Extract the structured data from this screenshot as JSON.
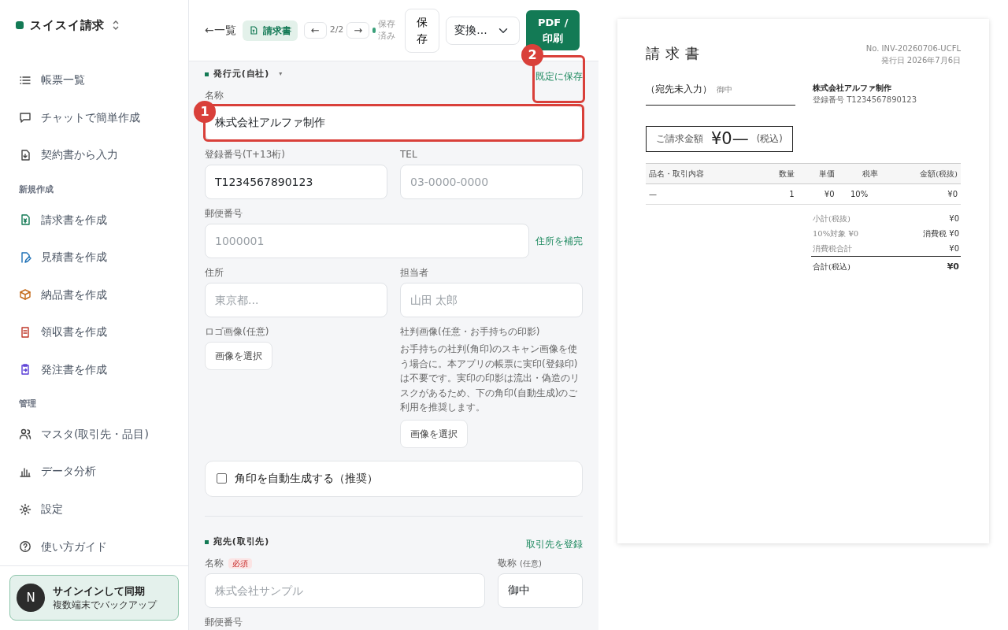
{
  "sidebar": {
    "brand": "スイスイ請求",
    "groups": [
      {
        "items": [
          {
            "label": "帳票一覧"
          },
          {
            "label": "チャットで簡単作成"
          },
          {
            "label": "契約書から入力"
          }
        ]
      },
      {
        "heading": "新規作成",
        "items": [
          {
            "label": "請求書を作成"
          },
          {
            "label": "見積書を作成"
          },
          {
            "label": "納品書を作成"
          },
          {
            "label": "領収書を作成"
          },
          {
            "label": "発注書を作成"
          }
        ]
      },
      {
        "heading": "管理",
        "items": [
          {
            "label": "マスタ(取引先・品目)"
          },
          {
            "label": "データ分析"
          },
          {
            "label": "設定"
          },
          {
            "label": "使い方ガイド"
          }
        ]
      }
    ],
    "signin": {
      "avatar": "N",
      "title": "サインインして同期",
      "subtitle": "複数端末でバックアップ"
    }
  },
  "toolbar": {
    "back": "←一覧",
    "doc_badge": "請求書",
    "prev": "←",
    "page": "2/2",
    "next": "→",
    "status": "保存済み",
    "save": "保存",
    "convert": "変換...",
    "pdf": "PDF / 印刷"
  },
  "issuer": {
    "title": "発行元(自社)",
    "toggle": "▾",
    "action": "既定に保存",
    "action_annotation": "2",
    "name": {
      "label": "名称",
      "value": "株式会社アルファ制作",
      "annotation": "1"
    },
    "reg": {
      "label": "登録番号(T+13桁)",
      "value": "T1234567890123"
    },
    "tel": {
      "label": "TEL",
      "placeholder": "03-0000-0000"
    },
    "zip": {
      "label": "郵便番号",
      "placeholder": "1000001",
      "action": "住所を補完"
    },
    "address": {
      "label": "住所",
      "placeholder": "東京都..."
    },
    "person": {
      "label": "担当者",
      "placeholder": "山田 太郎"
    },
    "logo": {
      "label": "ロゴ画像(任意)",
      "button": "画像を選択"
    },
    "seal": {
      "label": "社判画像(任意・お手持ちの印影)",
      "help": "お手持ちの社判(角印)のスキャン画像を使う場合に。本アプリの帳票に実印(登録印)は不要です。実印の印影は流出・偽造のリスクがあるため、下の角印(自動生成)のご利用を推奨します。",
      "button": "画像を選択"
    },
    "auto_seal": {
      "label": "角印を自動生成する（推奨）",
      "checked": false
    }
  },
  "recipient": {
    "title": "宛先(取引先)",
    "action": "取引先を登録",
    "name": {
      "label": "名称",
      "badge": "必須",
      "placeholder": "株式会社サンプル"
    },
    "honorific": {
      "label": "敬称",
      "note": "(任意)",
      "value": "御中"
    },
    "zip": {
      "label": "郵便番号"
    }
  },
  "preview": {
    "title": "請求書",
    "number": "No. INV-20260706-UCFL",
    "date": "発行日 2026年7月6日",
    "recipient": "（宛先未入力）",
    "honorific": "御中",
    "issuer": "株式会社アルファ制作",
    "reg": "登録番号 T1234567890123",
    "amount_label": "ご請求金額",
    "amount": "¥0—",
    "amount_note": "(税込)",
    "columns": [
      "品名・取引内容",
      "数量",
      "単価",
      "税率",
      "金額(税抜)"
    ],
    "rows": [
      [
        "—",
        "1",
        "¥0",
        "10%",
        "¥0"
      ]
    ],
    "summary": [
      {
        "label": "小計(税抜)",
        "value": "¥0",
        "kind": "line"
      },
      {
        "label": "10%対象 ¥0",
        "value": "消費税 ¥0",
        "kind": "line"
      },
      {
        "label": "消費税合計",
        "value": "¥0",
        "kind": "line"
      },
      {
        "label": "合計(税込)",
        "value": "¥0",
        "kind": "total"
      }
    ]
  }
}
